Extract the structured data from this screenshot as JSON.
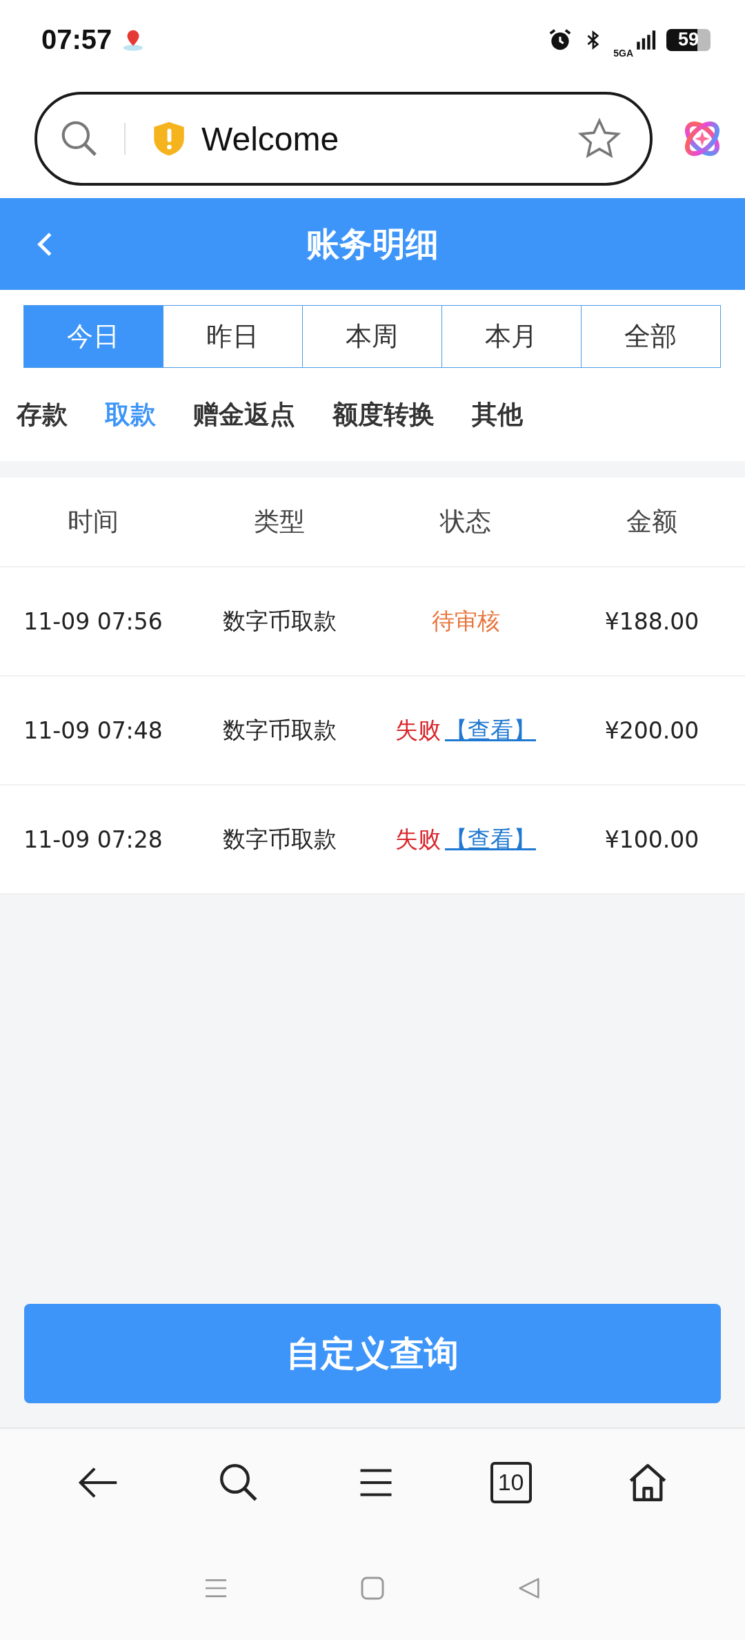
{
  "status_bar": {
    "time": "07:57",
    "network": "5GA",
    "battery": "59"
  },
  "browser": {
    "address": "Welcome",
    "tab_count": "10"
  },
  "header": {
    "title": "账务明细"
  },
  "period_tabs": [
    {
      "label": "今日",
      "selected": true
    },
    {
      "label": "昨日",
      "selected": false
    },
    {
      "label": "本周",
      "selected": false
    },
    {
      "label": "本月",
      "selected": false
    },
    {
      "label": "全部",
      "selected": false
    }
  ],
  "categories": [
    {
      "label": "存款",
      "selected": false
    },
    {
      "label": "取款",
      "selected": true
    },
    {
      "label": "赠金返点",
      "selected": false
    },
    {
      "label": "额度转换",
      "selected": false
    },
    {
      "label": "其他",
      "selected": false
    }
  ],
  "table": {
    "columns": [
      "时间",
      "类型",
      "状态",
      "金额"
    ],
    "rows": [
      {
        "time": "11-09 07:56",
        "type": "数字币取款",
        "status": {
          "text": "待审核",
          "kind": "pending"
        },
        "amount": "¥188.00"
      },
      {
        "time": "11-09 07:48",
        "type": "数字币取款",
        "status": {
          "text": "失败",
          "kind": "failed",
          "link": "【查看】"
        },
        "amount": "¥200.00"
      },
      {
        "time": "11-09 07:28",
        "type": "数字币取款",
        "status": {
          "text": "失败",
          "kind": "failed",
          "link": "【查看】"
        },
        "amount": "¥100.00"
      }
    ]
  },
  "query_button": "自定义查询"
}
